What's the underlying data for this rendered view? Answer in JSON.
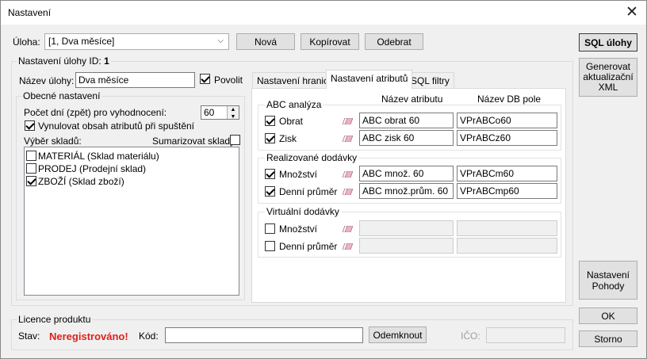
{
  "window": {
    "title": "Nastavení"
  },
  "top": {
    "task_label": "Úloha:",
    "task_value": "[1, Dva měsíce]",
    "new_button": "Nová",
    "copy_button": "Kopírovat",
    "delete_button": "Odebrat",
    "sql_button": "SQL úlohy"
  },
  "task_settings": {
    "group_title": "Nastavení úlohy ID:",
    "id_value": "1",
    "name_label": "Název úlohy:",
    "name_value": "Dva měsíce",
    "enable_label": "Povolit",
    "enable_checked": true
  },
  "general": {
    "group_title": "Obecné nastavení",
    "days_label": "Počet dní (zpět) pro vyhodnocení:",
    "days_value": "60",
    "reset_label": "Vynulovat obsah atributů při spuštění",
    "reset_checked": true,
    "stores_label": "Výběr skladů:",
    "summarize_label": "Sumarizovat sklady",
    "summarize_checked": false,
    "stores": [
      {
        "label": "MATERIÁL (Sklad materiálu)",
        "checked": false
      },
      {
        "label": "PRODEJ (Prodejní sklad)",
        "checked": false
      },
      {
        "label": "ZBOŽÍ (Sklad zboží)",
        "checked": true
      }
    ]
  },
  "tabs": [
    {
      "label": "Nastavení hranic",
      "active": false
    },
    {
      "label": "Nastavení atributů",
      "active": true
    },
    {
      "label": "SQL filtry",
      "active": false
    }
  ],
  "attributes": {
    "col_attr_name": "Název atributu",
    "col_db_name": "Název DB pole",
    "abc": {
      "title": "ABC analýza",
      "rows": [
        {
          "label": "Obrat",
          "checked": true,
          "attr": "ABC obrat 60",
          "db": "VPrABCo60"
        },
        {
          "label": "Zisk",
          "checked": true,
          "attr": "ABC zisk 60",
          "db": "VPrABCz60"
        }
      ]
    },
    "realized": {
      "title": "Realizované dodávky",
      "rows": [
        {
          "label": "Množství",
          "checked": true,
          "attr": "ABC množ. 60",
          "db": "VPrABCm60"
        },
        {
          "label": "Denní průměr",
          "checked": true,
          "attr": "ABC množ.prům. 60",
          "db": "VPrABCmp60"
        }
      ]
    },
    "virtual": {
      "title": "Virtuální dodávky",
      "rows": [
        {
          "label": "Množství",
          "checked": false,
          "attr": "",
          "db": ""
        },
        {
          "label": "Denní průměr",
          "checked": false,
          "attr": "",
          "db": ""
        }
      ]
    }
  },
  "right_buttons": {
    "generate": "Generovat aktualizační XML",
    "pohoda": "Nastavení Pohody",
    "ok": "OK",
    "cancel": "Storno"
  },
  "license": {
    "group_title": "Licence produktu",
    "status_label": "Stav:",
    "status_value": "Neregistrováno!",
    "code_label": "Kód:",
    "code_value": "",
    "unlock_button": "Odemknout",
    "ico_label": "IČO:",
    "ico_value": ""
  }
}
